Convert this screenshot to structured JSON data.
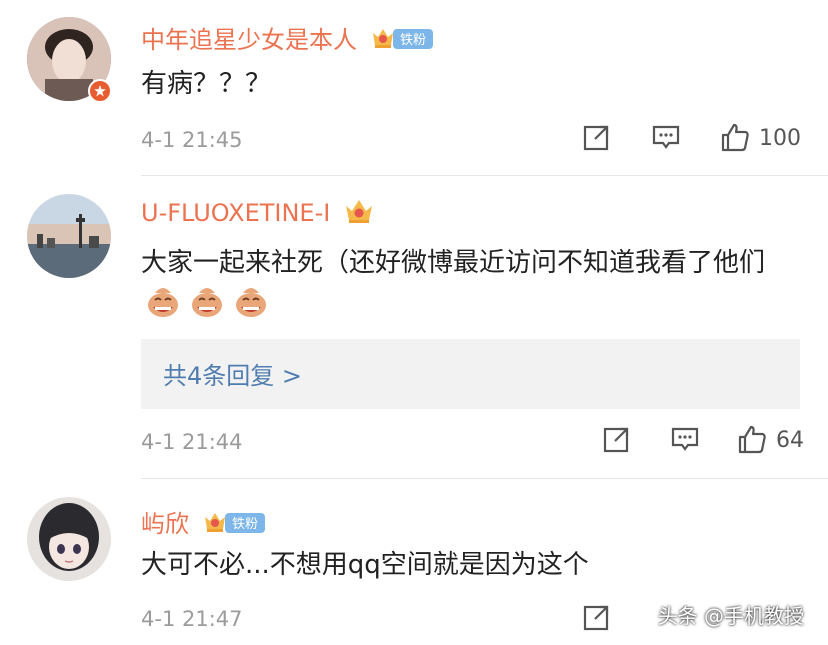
{
  "comments": [
    {
      "username": "中年追星少女是本人",
      "badge": "铁粉",
      "badge_level": "6",
      "text": "有病？？？",
      "time": "4-1 21:45",
      "likes": "100"
    },
    {
      "username": "U-FLUOXETINE-I",
      "badge_level": "7",
      "text": "大家一起来社死（还好微博最近访问不知道我看了他们",
      "replies_label": "共4条回复 >",
      "time": "4-1 21:44",
      "likes": "64"
    },
    {
      "username": "屿欣",
      "badge": "铁粉",
      "badge_level": "6",
      "text": "大可不必...不想用qq空间就是因为这个",
      "time": "4-1 21:47"
    }
  ],
  "watermark": "头条 @手机教授",
  "colors": {
    "username": "#eb7350",
    "link": "#507daf",
    "meta": "#9b9b9b"
  }
}
